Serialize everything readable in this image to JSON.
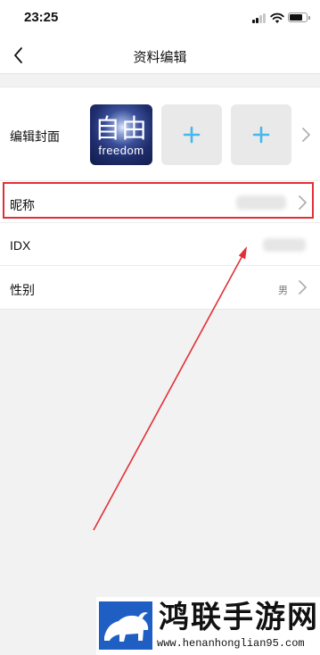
{
  "status_bar": {
    "time": "23:25",
    "signal_bars_active": 2,
    "signal_bars_total": 4,
    "battery_fraction": 0.8,
    "signal_icon": "signal-icon",
    "wifi_icon": "wifi-icon",
    "battery_icon": "battery-icon"
  },
  "nav": {
    "back_icon": "chevron-left-icon",
    "title": "资料编辑"
  },
  "form": {
    "cover": {
      "label": "编辑封面",
      "image_text_large": "自由",
      "image_text_small": "freedom",
      "add_icon": "plus-icon",
      "add_slot_count": 2,
      "chevron_icon": "chevron-right-icon"
    },
    "nickname": {
      "label": "昵称",
      "value_hidden": true,
      "chevron_icon": "chevron-right-icon"
    },
    "idx": {
      "label": "IDX",
      "value_hidden": true
    },
    "gender": {
      "label": "性别",
      "value": "男",
      "chevron_icon": "chevron-right-icon"
    }
  },
  "colors": {
    "accent_plus": "#46b8ee",
    "annotation_red": "#e22f37",
    "background": "#f2f2f2",
    "watermark_blue": "#1f5fc4"
  },
  "watermark": {
    "title": "鸿联手游网",
    "url": "www.henanhonglian95.com"
  }
}
